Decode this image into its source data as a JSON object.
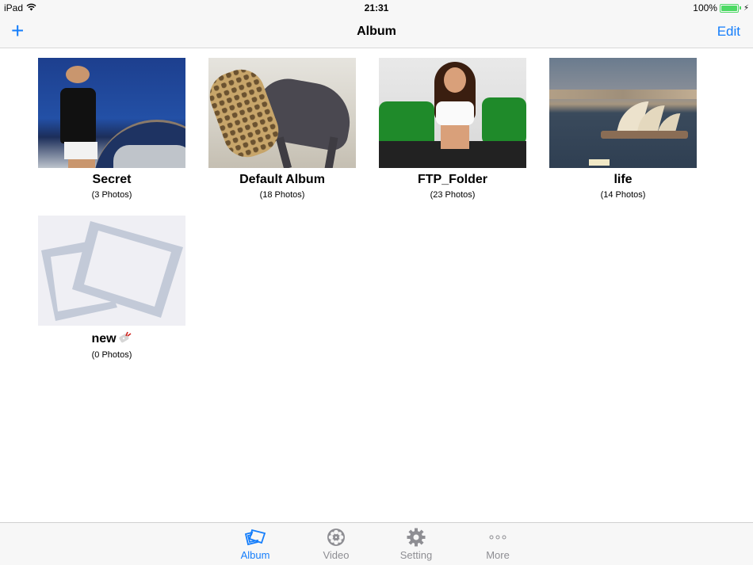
{
  "status_bar": {
    "device": "iPad",
    "time": "21:31",
    "battery": "100%",
    "battery_level": 1.0,
    "wifi_icon": "wifi-icon",
    "charging_icon": "bolt-icon"
  },
  "nav": {
    "title": "Album",
    "add_icon": "plus-icon",
    "add_label": "+",
    "edit_label": "Edit"
  },
  "albums": [
    {
      "name": "Secret",
      "count": "(3 Photos)",
      "thumb": "photo-woman-car"
    },
    {
      "name": "Default Album",
      "count": "(18 Photos)",
      "thumb": "photo-leopard-wildebeest"
    },
    {
      "name": "FTP_Folder",
      "count": "(23 Photos)",
      "thumb": "photo-woman-motorcycles"
    },
    {
      "name": "life",
      "count": "(14 Photos)",
      "thumb": "photo-sydney-opera-house"
    },
    {
      "name": "new",
      "count": "(0 Photos)",
      "thumb": "empty-album-placeholder",
      "badge_icon": "lock-tag-icon"
    }
  ],
  "tabs": [
    {
      "label": "Album",
      "icon": "album-icon",
      "active": true
    },
    {
      "label": "Video",
      "icon": "film-reel-icon",
      "active": false
    },
    {
      "label": "Setting",
      "icon": "gear-icon",
      "active": false
    },
    {
      "label": "More",
      "icon": "more-dots-icon",
      "active": false
    }
  ],
  "colors": {
    "accent": "#157efb",
    "inactive_tab": "#8e8e93",
    "battery": "#4cd964",
    "bar_background": "#f7f7f7"
  }
}
